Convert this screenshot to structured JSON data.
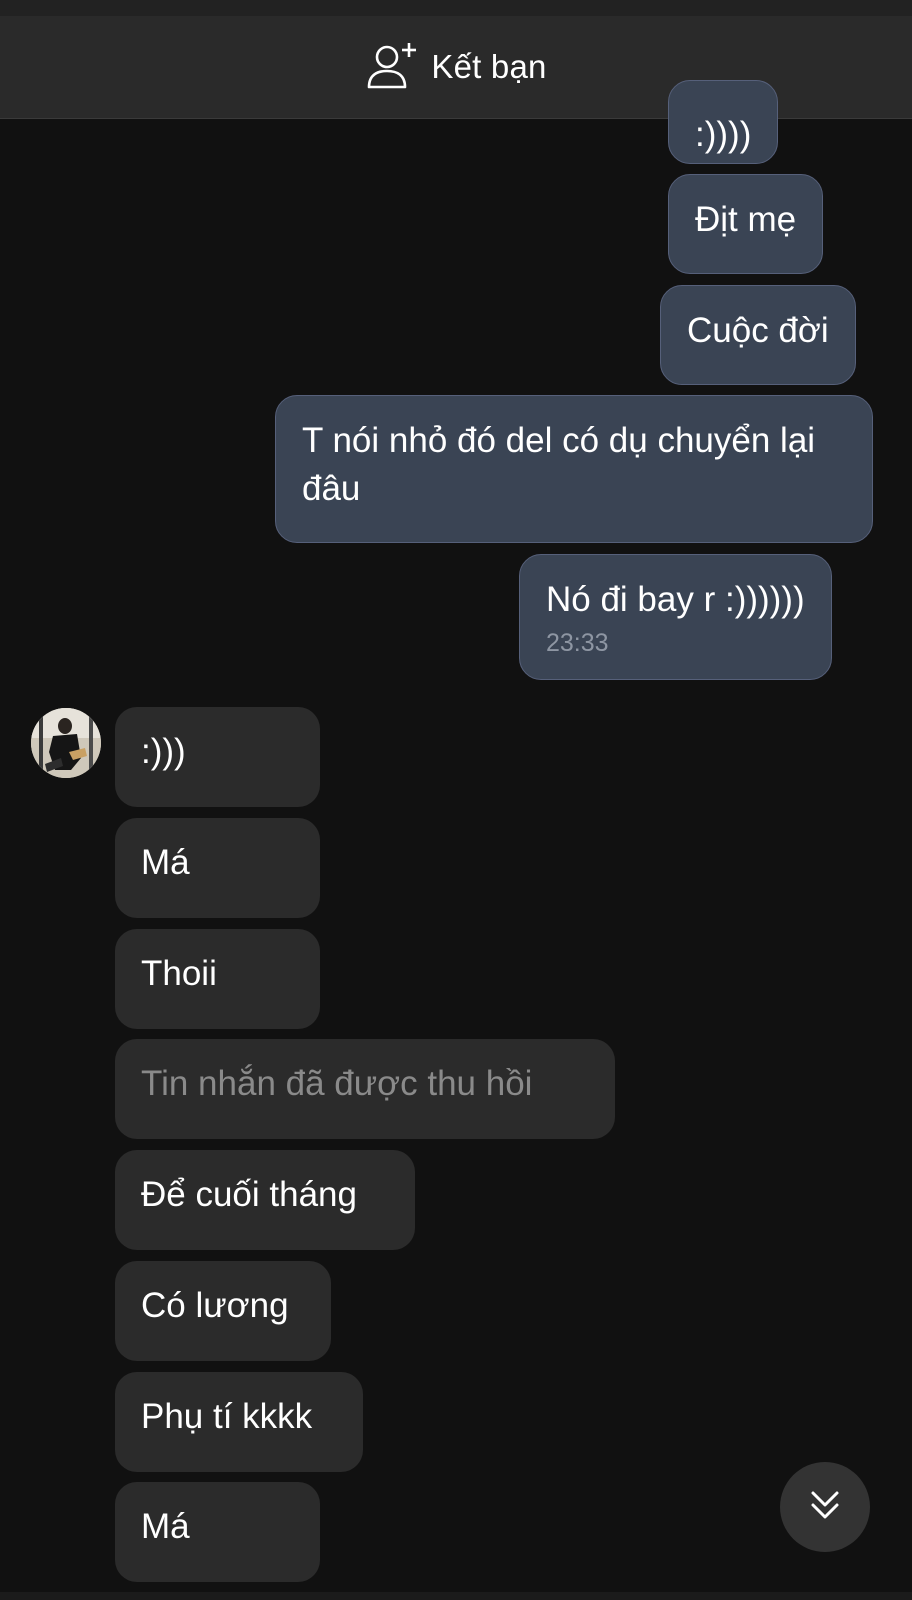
{
  "header": {
    "add_friend_label": "Kết bạn"
  },
  "messages": {
    "outgoing": [
      {
        "text": ":))))"
      },
      {
        "text": "Địt mẹ"
      },
      {
        "text": "Cuộc đời"
      },
      {
        "text": "T nói nhỏ đó del có dụ chuyển lại đâu"
      },
      {
        "text": "Nó đi bay r :))))))",
        "time": "23:33"
      }
    ],
    "incoming": [
      {
        "text": ":)))"
      },
      {
        "text": "Má"
      },
      {
        "text": "Thoii"
      },
      {
        "text": "Tin nhắn đã được thu hồi",
        "recalled": true
      },
      {
        "text": "Để cuối tháng"
      },
      {
        "text": "Có lương"
      },
      {
        "text": "Phụ tí kkkk"
      },
      {
        "text": "Má"
      }
    ]
  },
  "colors": {
    "outgoing_bubble": "#3a4454",
    "incoming_bubble": "#2b2b2b",
    "background": "#111111",
    "header": "#2a2a2a"
  },
  "icons": {
    "header": "add-friend-icon",
    "scroll": "double-chevron-down-icon"
  }
}
